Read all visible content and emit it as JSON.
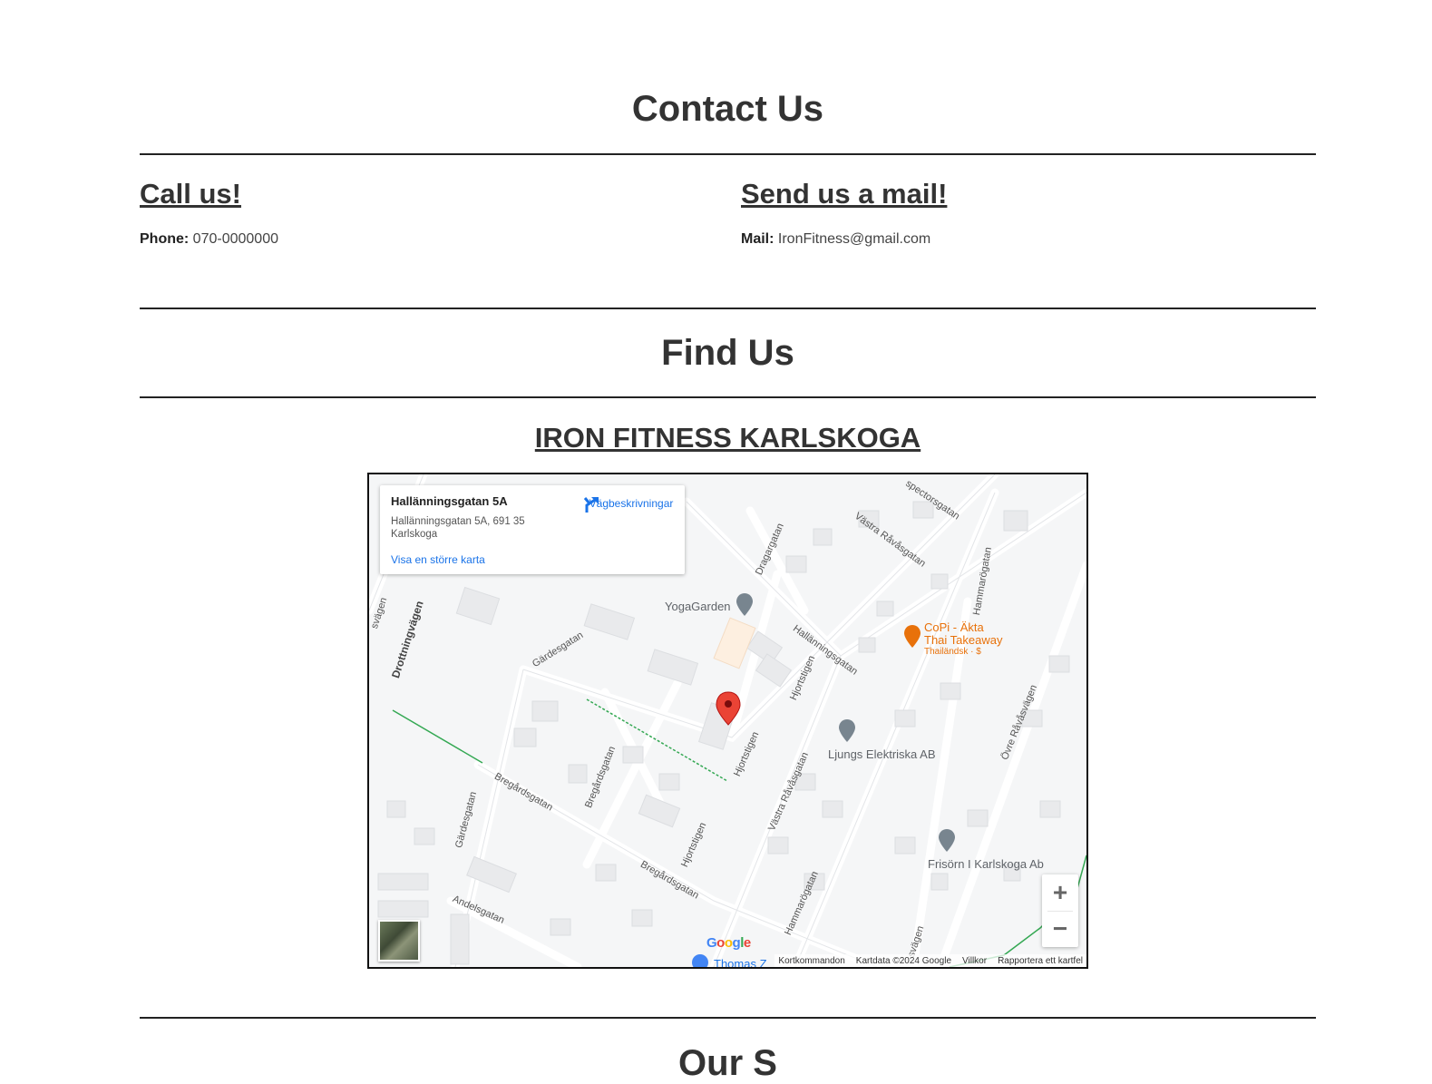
{
  "contact": {
    "title": "Contact Us",
    "call": {
      "heading": "Call us!",
      "label": "Phone:",
      "value": "070-0000000"
    },
    "mail": {
      "heading": "Send us a mail!",
      "label": "Mail:",
      "value": "IronFitness@gmail.com"
    }
  },
  "find": {
    "title": "Find Us",
    "location_name": "IRON FITNESS KARLSKOGA"
  },
  "map": {
    "card": {
      "title": "Hallänningsgatan 5A",
      "address": "Hallänningsgatan 5A, 691 35 Karlskoga",
      "larger_map": "Visa en större karta",
      "directions": "Vägbeskrivningar"
    },
    "pois": {
      "yoga": "YogaGarden",
      "copi_1": "CoPi - Äkta",
      "copi_2": "Thai Takeaway",
      "copi_sub": "Thailändsk · $",
      "ljungs": "Ljungs Elektriska AB",
      "frisorn": "Frisörn I Karlskoga Ab",
      "thomas": "Thomas Z"
    },
    "streets": {
      "drottning": "Drottningvägen",
      "gardesgatan": "Gärdesgatan",
      "gardesgatan2": "Gärdesgatan",
      "bregardsgatan": "Bregårdsgatan",
      "bregardsgatan2": "Bregårdsgatan",
      "bregardsgatan3": "Bregårdsgatan",
      "hjortstigen": "Hjortstigen",
      "hjortstigen2": "Hjortstigen",
      "hjortstigen3": "Hjortstigen",
      "hallannings": "Hallänningsgatan",
      "vastra1": "Västra Råvåsgatan",
      "vastra2": "Västra Råvåsgatan",
      "dragargatan": "Dragargatan",
      "hammaro": "Hammarögatan",
      "hammaro2": "Hammarögatan",
      "ovre": "Övre Råvåsvägen",
      "andels": "Andelsgatan",
      "spector": "spectorsgatan",
      "svagen": "svägen",
      "svagen2": "svägen"
    },
    "attribution": {
      "shortcuts": "Kortkommandon",
      "data": "Kartdata ©2024 Google",
      "terms": "Villkor",
      "report": "Rapportera ett kartfel"
    },
    "zoom_in": "+",
    "zoom_out": "−",
    "google": [
      "G",
      "o",
      "o",
      "g",
      "l",
      "e"
    ]
  },
  "next_section_partial": "Our S"
}
